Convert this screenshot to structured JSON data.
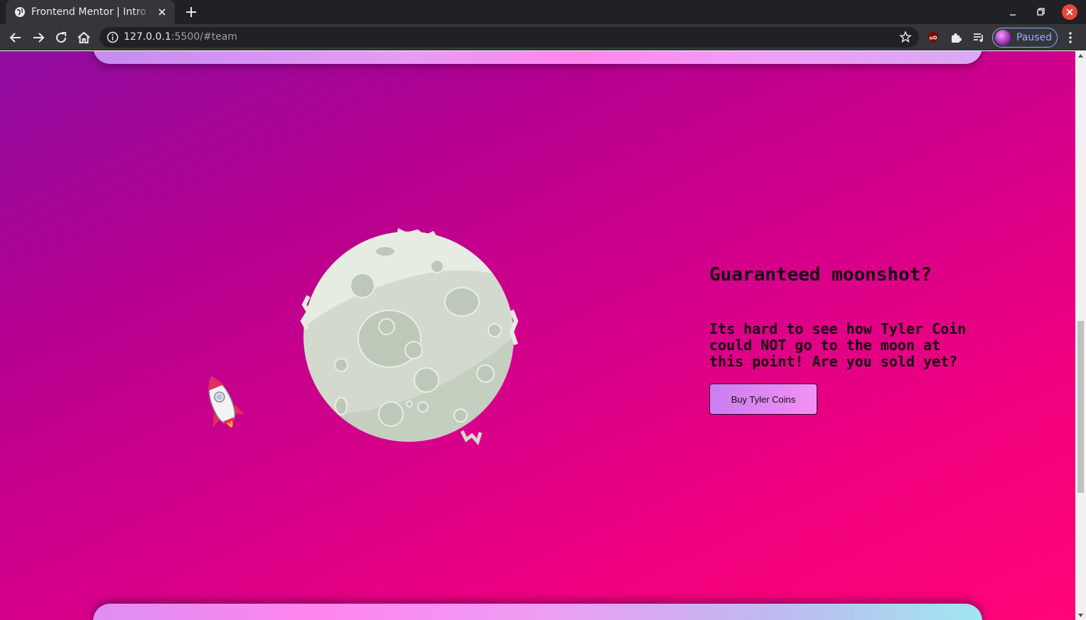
{
  "browser": {
    "tab_title": "Frontend Mentor | Intro component with sign up form",
    "url_host": "127.0.0.1",
    "url_rest": ":5500/#team",
    "profile_label": "Paused"
  },
  "section": {
    "heading": "Guaranteed moonshot?",
    "body": "Its hard to see how Tyler Coin could NOT go to the moon at this point! Are you sold yet?",
    "button_label": "Buy Tyler Coins"
  },
  "colors": {
    "gradient_start": "#8e0ca0",
    "gradient_end": "#ff0577",
    "panel_pink": "#ff86ee",
    "moon": "#d4dccd",
    "text": "#160012"
  },
  "scroll_position": 0.47
}
